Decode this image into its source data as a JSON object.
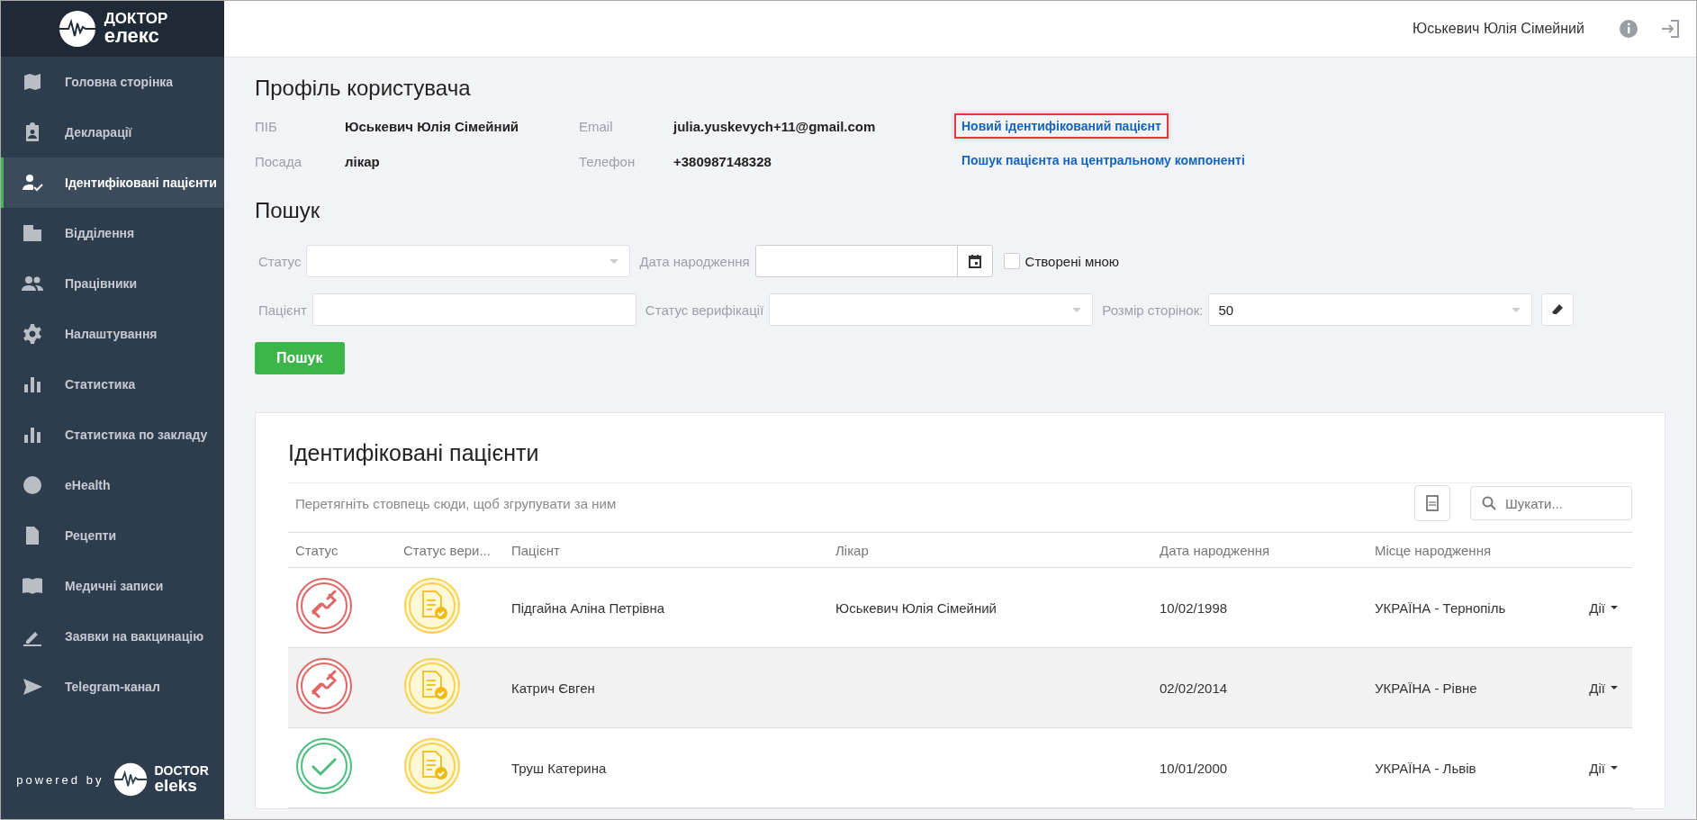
{
  "logo": {
    "line_1": "ДОКТОР",
    "line_2": "елекс"
  },
  "header": {
    "user_name": "Юськевич Юлія Сімейний"
  },
  "sidebar": {
    "items": [
      {
        "label": "Головна сторінка",
        "selected": false
      },
      {
        "label": "Декларації",
        "selected": false
      },
      {
        "label": "Ідентифіковані пацієнти",
        "selected": true
      },
      {
        "label": "Відділення",
        "selected": false
      },
      {
        "label": "Працівники",
        "selected": false
      },
      {
        "label": "Налаштування",
        "selected": false
      },
      {
        "label": "Статистика",
        "selected": false
      },
      {
        "label": "Статистика по закладу",
        "selected": false
      },
      {
        "label": "eHealth",
        "selected": false
      },
      {
        "label": "Рецепти",
        "selected": false
      },
      {
        "label": "Медичні записи",
        "selected": false
      },
      {
        "label": "Заявки на вакцинацію",
        "selected": false
      },
      {
        "label": "Telegram-канал",
        "selected": false
      }
    ],
    "footer": {
      "powered_by": "powered by",
      "logo_line_1": "DOCTOR",
      "logo_line_2": "eleks"
    }
  },
  "profile": {
    "title": "Профіль користувача",
    "fields": [
      {
        "label": "ПІБ",
        "value": "Юськевич Юлія Сімейний"
      },
      {
        "label": "Email",
        "value": "julia.yuskevych+11@gmail.com"
      },
      {
        "label": "Посада",
        "value": "лікар"
      },
      {
        "label": "Телефон",
        "value": "+380987148328"
      }
    ],
    "links": [
      {
        "label": "Новий ідентифікований пацієнт",
        "highlighted": true
      },
      {
        "label": "Пошук пацієнта на центральному компоненті",
        "highlighted": false
      }
    ]
  },
  "search": {
    "title": "Пошук",
    "status": {
      "label": "Статус"
    },
    "birth_date": {
      "label": "Дата народження"
    },
    "created_by_me": {
      "label": "Створені мною",
      "checked": false
    },
    "patient": {
      "label": "Пацієнт"
    },
    "verification": {
      "label": "Статус верифікації"
    },
    "page_size": {
      "label": "Розмір сторінок:",
      "value": "50"
    },
    "button": "Пошук"
  },
  "table": {
    "title": "Ідентифіковані пацієнти",
    "group_hint": "Перетягніть стовпець сюди, щоб згрупувати за ним",
    "search_placeholder": "Шукати...",
    "columns": [
      "Статус",
      "Статус вери...",
      "Пацієнт",
      "Лікар",
      "Дата народження",
      "Місце народження"
    ],
    "rows": [
      {
        "status_badge": {
          "kind": "unlinked"
        },
        "verification_badge": {
          "kind": "verified"
        },
        "patient": "Підгайна Аліна Петрівна",
        "doctor": "Юськевич Юлія Сімейний",
        "birth_date": "10/02/1998",
        "birth_place": "УКРАЇНА - Тернопіль",
        "actions": "Дії",
        "selected": false
      },
      {
        "status_badge": {
          "kind": "unlinked"
        },
        "verification_badge": {
          "kind": "verified"
        },
        "patient": "Катрич Євген",
        "birth_date": "02/02/2014",
        "birth_place": "УКРАЇНА - Рівне",
        "actions": "Дії",
        "selected": true
      },
      {
        "status_badge": {
          "kind": "linked"
        },
        "verification_badge": {
          "kind": "verified"
        },
        "patient": "Труш Катерина",
        "birth_date": "10/01/2000",
        "birth_place": "УКРАЇНА - Львів",
        "actions": "Дії",
        "selected": false
      }
    ]
  }
}
